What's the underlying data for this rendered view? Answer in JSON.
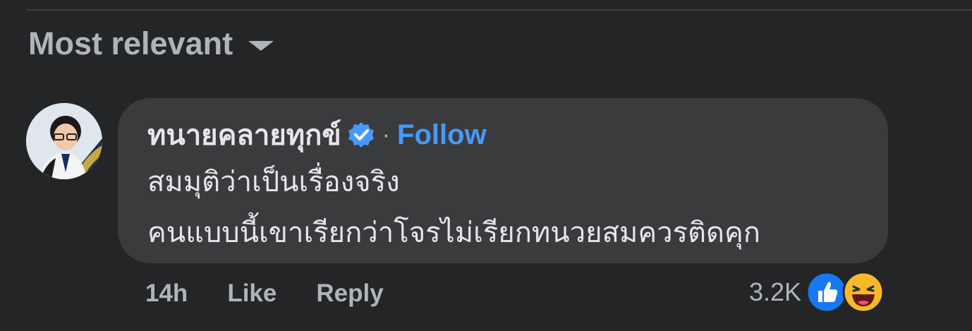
{
  "sort": {
    "label": "Most relevant",
    "icon": "caret-down-icon"
  },
  "comment": {
    "author": "ทนายคลายทุกข์",
    "verified_icon": "verified-badge-icon",
    "separator": "·",
    "follow_label": "Follow",
    "text_lines": [
      "สมมุติว่าเป็นเรื่องจริง",
      "คนแบบนี้เขาเรียกว่าโจรไม่เรียกทนวยสมควรติดคุก"
    ],
    "time": "14h",
    "like_label": "Like",
    "reply_label": "Reply",
    "reaction_count": "3.2K",
    "reactions": [
      "like-reaction-icon",
      "haha-reaction-icon"
    ]
  },
  "colors": {
    "background": "#242526",
    "bubble": "#3a3b3c",
    "primary_text": "#e4e6eb",
    "secondary_text": "#b0b3b8",
    "link": "#4599ff",
    "like_blue": "#1877f2",
    "haha_yellow": "#f7b928"
  }
}
